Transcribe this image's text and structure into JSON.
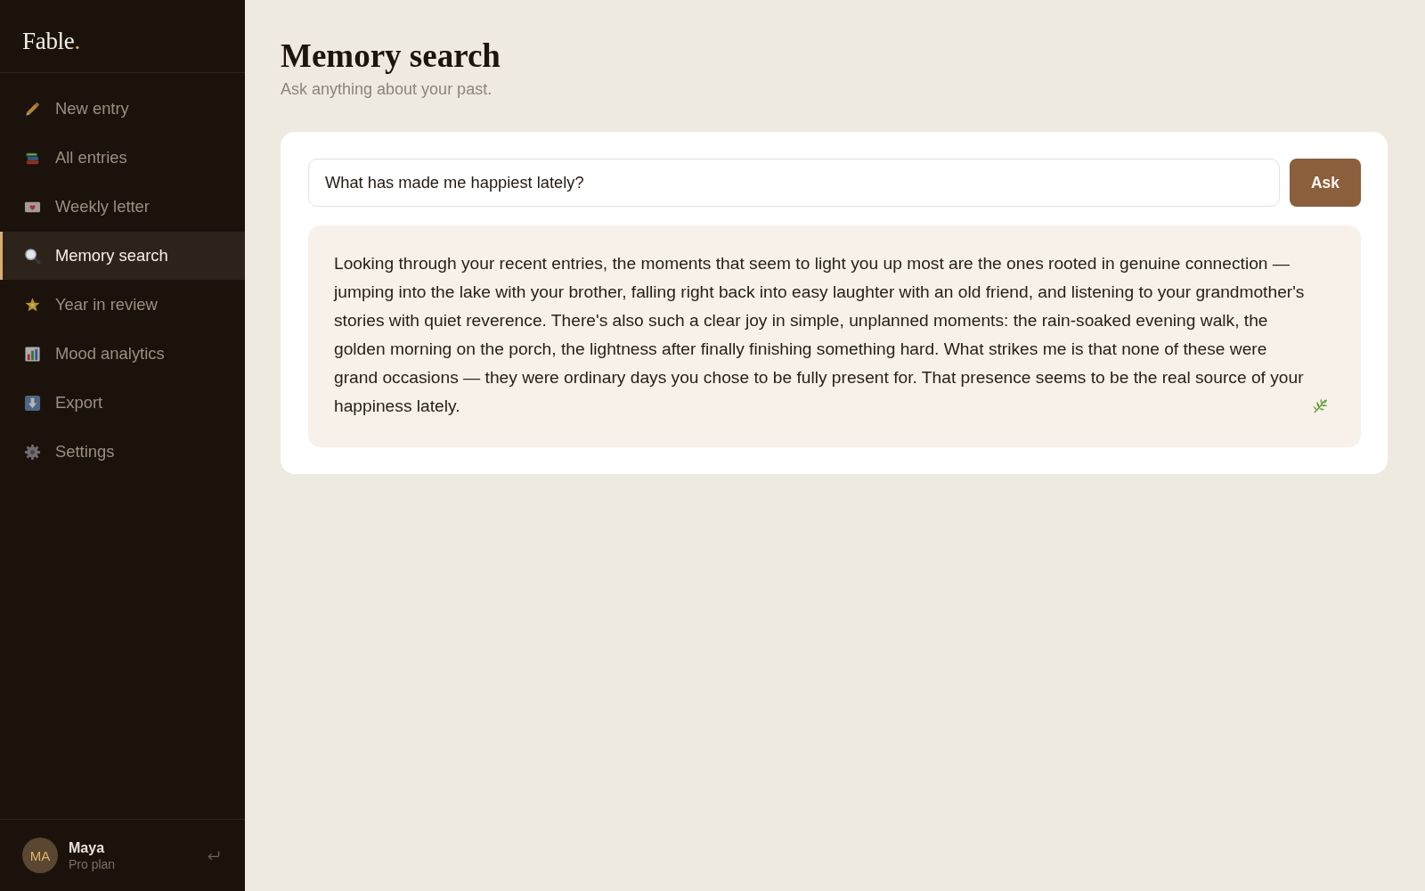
{
  "sidebar": {
    "logo": {
      "text": "Fable",
      "dot": "."
    },
    "nav_items": [
      {
        "label": "New entry",
        "selected": false
      },
      {
        "label": "All entries",
        "selected": false
      },
      {
        "label": "Weekly letter",
        "selected": false
      },
      {
        "label": "Memory search",
        "selected": true
      },
      {
        "label": "Year in review",
        "selected": false
      },
      {
        "label": "Mood analytics",
        "selected": false
      },
      {
        "label": "Export",
        "selected": false
      },
      {
        "label": "Settings",
        "selected": false
      }
    ],
    "user": {
      "initials": "MA",
      "name": "Maya",
      "plan": "Pro plan"
    }
  },
  "header": {
    "title": "Memory search",
    "subtitle": "Ask anything about your past."
  },
  "search": {
    "query": {
      "value": "What has made me happiest lately?"
    },
    "button": "Ask"
  },
  "answer": {
    "text": "Looking through your recent entries, the moments that seem to light you up most are the ones rooted in genuine connection — jumping into the lake with your brother, falling right back into easy laughter with an old friend, and listening to your grandmother's stories with quiet reverence. There's also such a clear joy in simple, unplanned moments: the rain-soaked evening walk, the golden morning on the porch, the lightness after finally finishing something hard. What strikes me is that none of these were grand occasions — they were ordinary days you chose to be fully present for. That presence seems to be the real source of your happiness lately."
  }
}
